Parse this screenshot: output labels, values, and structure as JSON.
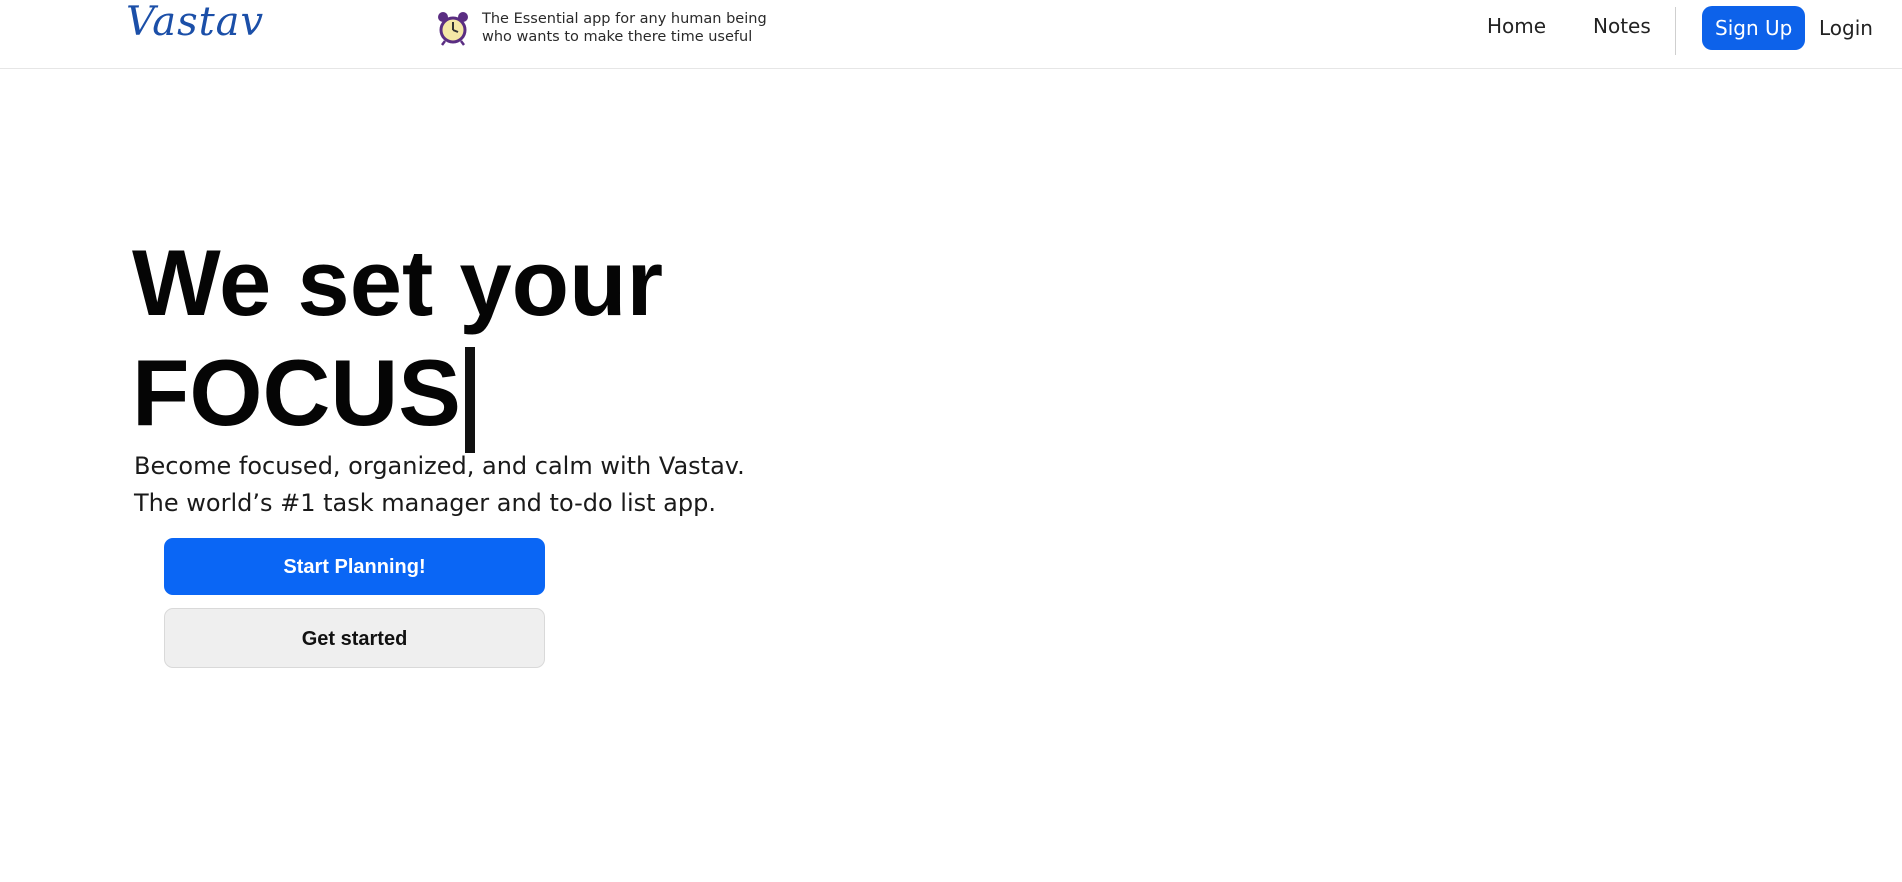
{
  "header": {
    "logo": "Vastav",
    "tagline_line1": "The Essential app for any human being",
    "tagline_line2": "who wants to make there time useful",
    "tagline_icon": "alarm-clock-icon",
    "nav": {
      "home": "Home",
      "notes": "Notes",
      "signup": "Sign Up",
      "login": "Login"
    }
  },
  "hero": {
    "title_line1": "We set your",
    "title_line2": "FOCUS",
    "subtitle_line1": "Become focused, organized, and calm with Vastav.",
    "subtitle_line2": "The world’s #1 task manager and to-do list app.",
    "primary_button": "Start Planning!",
    "secondary_button": "Get started"
  },
  "colors": {
    "accent": "#0a66f5",
    "logo": "#1b4fa8",
    "secondary_button_bg": "#efefef"
  }
}
